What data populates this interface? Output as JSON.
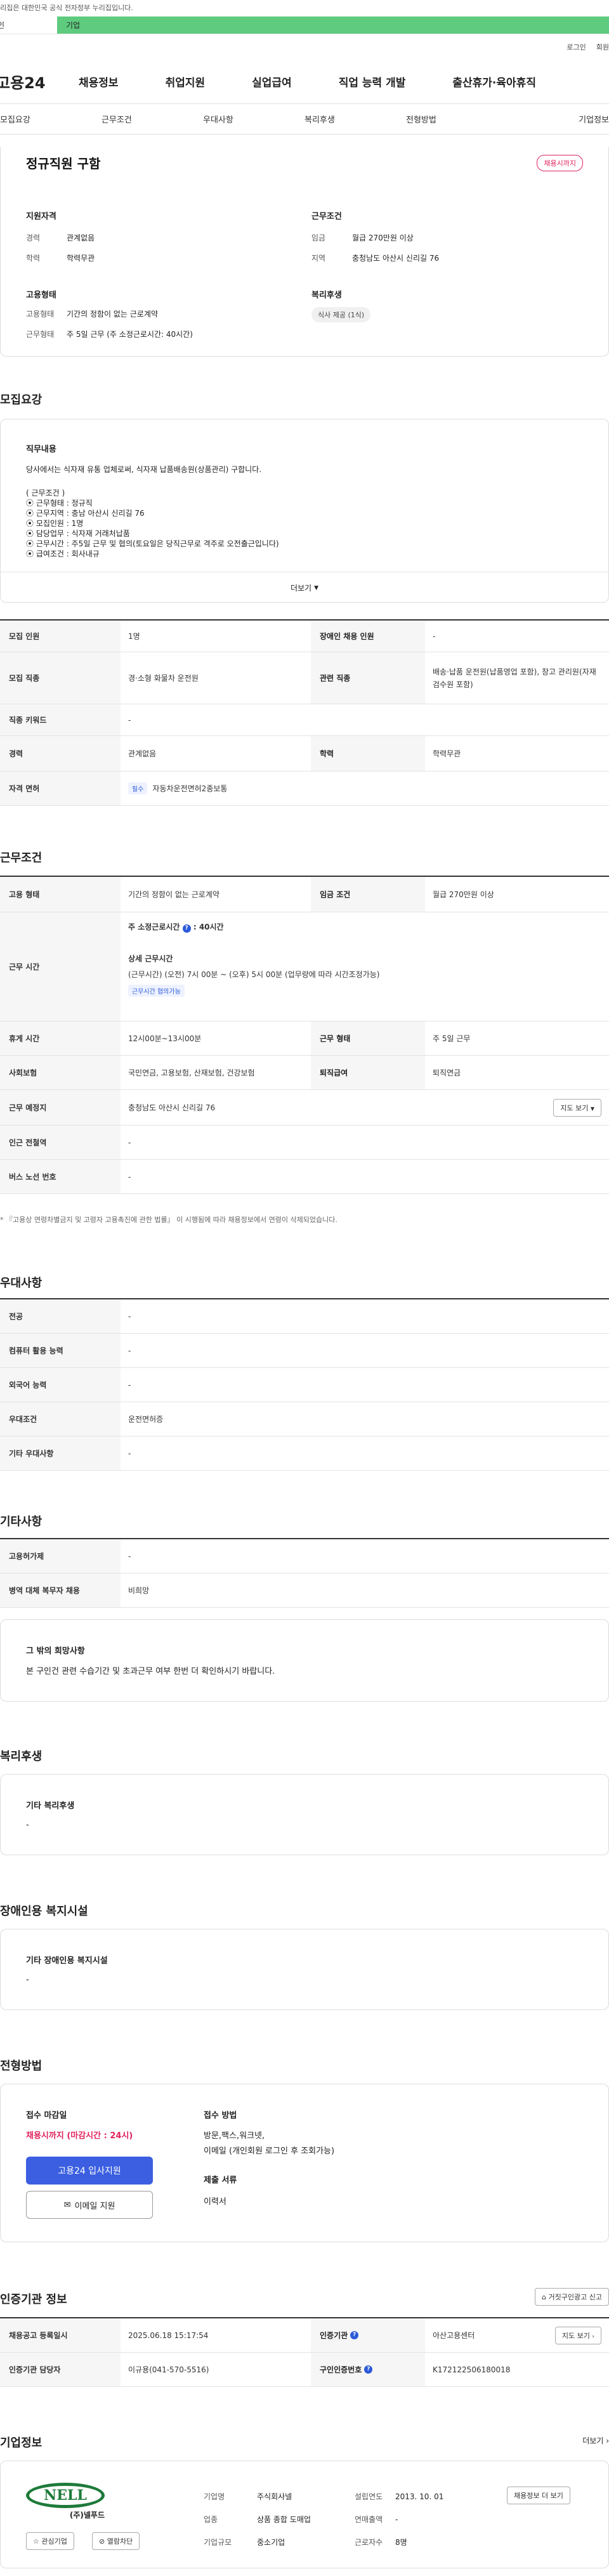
{
  "govbar": "누리집은 대한민국 공식 전자정부 누리집입니다.",
  "tabs": [
    "인",
    "기업"
  ],
  "util": [
    "로그인",
    "회원"
  ],
  "logo": "고용24",
  "gnb": [
    "채용정보",
    "취업지원",
    "실업급여",
    "직업 능력 개발",
    "출산휴가·육아휴직"
  ],
  "snb": [
    "모집요강",
    "근무조건",
    "우대사항",
    "복리후생",
    "전형방법",
    "기업정보"
  ],
  "summary": {
    "title": "정규직원 구함",
    "badge": "채용시까지",
    "qual_h": "지원자격",
    "career_l": "경력",
    "career_v": "관계없음",
    "edu_l": "학력",
    "edu_v": "학력무관",
    "cond_h": "근무조건",
    "wage_l": "임금",
    "wage_v": "월급 270만원 이상",
    "area_l": "지역",
    "area_v": "충청남도 아산시 신리길 76",
    "emp_h": "고용형태",
    "emp_l": "고용형태",
    "emp_v": "기간의 정함이 없는 근로계약",
    "work_l": "근무형태",
    "work_v": "주 5일 근무 (주 소정근로시간: 40시간)",
    "welfare_h": "복리후생",
    "welfare_tag": "식사 제공 (1식)"
  },
  "recruit": {
    "title": "모집요강",
    "job_h": "직무내용",
    "job_desc": "당사에서는 식자재 유통 업체로써, 식자재 납품배송원(상품관리) 구합니다.",
    "lines": [
      "( 근무조건 )",
      "⦿ 근무형태 :  정규직",
      "⦿ 근무지역 :  충남 아산시 신리길 76",
      "⦿ 모집인원 :  1명",
      "⦿ 담당업무 :  식자재 거래처납품",
      "⦿ 근무시간 :  주5일 근무 및 협의(토요일은 당직근무로 격주로 오전출근입니다)",
      "⦿ 급여조건 :  회사내규"
    ],
    "more": "더보기",
    "r1": [
      "모집 인원",
      "1명",
      "장애인 채용 인원",
      "-"
    ],
    "r2": [
      "모집 직종",
      "경·소형 화물차 운전원",
      "관련 직종",
      "배송·납품 운전원(납품영업 포함), 창고 관리원(자재 검수원 포함)"
    ],
    "r3": [
      "직종 키워드",
      "-"
    ],
    "r4": [
      "경력",
      "관계없음",
      "학력",
      "학력무관"
    ],
    "r5": [
      "자격 면허",
      "필수",
      "자동차운전면허2종보통"
    ]
  },
  "conditions": {
    "title": "근무조건",
    "r1": [
      "고용 형태",
      "기간의 정함이 없는 근로계약",
      "임금 조건",
      "월급 270만원 이상"
    ],
    "hours_h": "근무 시간",
    "hours_main": "주 소정근로시간",
    "hours_val": ": 40시간",
    "detail_h": "상세 근무시간",
    "detail_v": "(근무시간) (오전) 7시 00분 ~ (오후) 5시 00분 (업무량에 따라 시간조정가능)",
    "detail_tag": "근무시간 협의가능",
    "r3": [
      "휴게 시간",
      "12시00분~13시00분",
      "근무 형태",
      "주 5일 근무"
    ],
    "r4": [
      "사회보험",
      "국민연금, 고용보험, 산재보험, 건강보험",
      "퇴직급여",
      "퇴직연금"
    ],
    "r5": [
      "근무 예정지",
      "충청남도 아산시 신리길 76",
      "지도 보기"
    ],
    "r6": [
      "인근 전철역",
      "-"
    ],
    "r7": [
      "버스 노선 번호",
      "-"
    ],
    "footnote": "* 『고용상 연령차별금지 및 고령자 고용촉진에 관한 법률』 이 시행됨에 따라 채용정보에서 연령이 삭제되었습니다."
  },
  "prefer": {
    "title": "우대사항",
    "rows": [
      [
        "전공",
        "-"
      ],
      [
        "컴퓨터 활용 능력",
        "-"
      ],
      [
        "외국어 능력",
        "-"
      ],
      [
        "우대조건",
        "운전면허증"
      ],
      [
        "기타 우대사항",
        "-"
      ]
    ]
  },
  "etc": {
    "title": "기타사항",
    "rows": [
      [
        "고용허가제",
        "-"
      ],
      [
        "병역 대체 복무자 채용",
        "비희망"
      ]
    ],
    "box_h": "그 밖의 희망사항",
    "box_v": "본 구인건 관련 수습기간 및 초과근무 여부 한번 더 확인하시기 바랍니다."
  },
  "welfare": {
    "title": "복리후생",
    "box_h": "기타 복리후생",
    "box_v": "-"
  },
  "disabled": {
    "title": "장애인용 복지시설",
    "box_h": "기타 장애인용 복지시설",
    "box_v": "-"
  },
  "selection": {
    "title": "전형방법",
    "deadline_h": "접수 마감일",
    "deadline_v": "채용시까지 (마감시간 : 24시)",
    "apply_btn": "고용24 입사지원",
    "email_btn": "이메일 지원",
    "method_h": "접수 방법",
    "method_v1": "방문,팩스,워크넷,",
    "method_v2": "이메일 (개인회원 로그인 후 조회가능)",
    "docs_h": "제출 서류",
    "docs_v": "이력서"
  },
  "cert": {
    "title": "인증기관 정보",
    "report_btn": "거짓구인광고 신고",
    "r1": [
      "채용공고 등록일시",
      "2025.06.18 15:17:54",
      "인증기관",
      "아산고용센터"
    ],
    "map_btn": "지도 보기",
    "r2": [
      "인증기관 담당자",
      "이규용(041-570-5516)",
      "구인인증번호",
      "K172122506180018"
    ]
  },
  "company": {
    "title": "기업정보",
    "more": "더보기",
    "logo_text": "NELL",
    "logo_sub": "(주)넬푸드",
    "fav": "관심기업",
    "block": "열람차단",
    "rows": [
      [
        "기업명",
        "주식회사넬",
        "설립연도",
        "2013. 10. 01"
      ],
      [
        "업종",
        "상품 종합 도매업",
        "연매출액",
        "-"
      ],
      [
        "기업규모",
        "중소기업",
        "근로자수",
        "8명"
      ]
    ],
    "hiring_btn": "채용정보 더 보기"
  }
}
